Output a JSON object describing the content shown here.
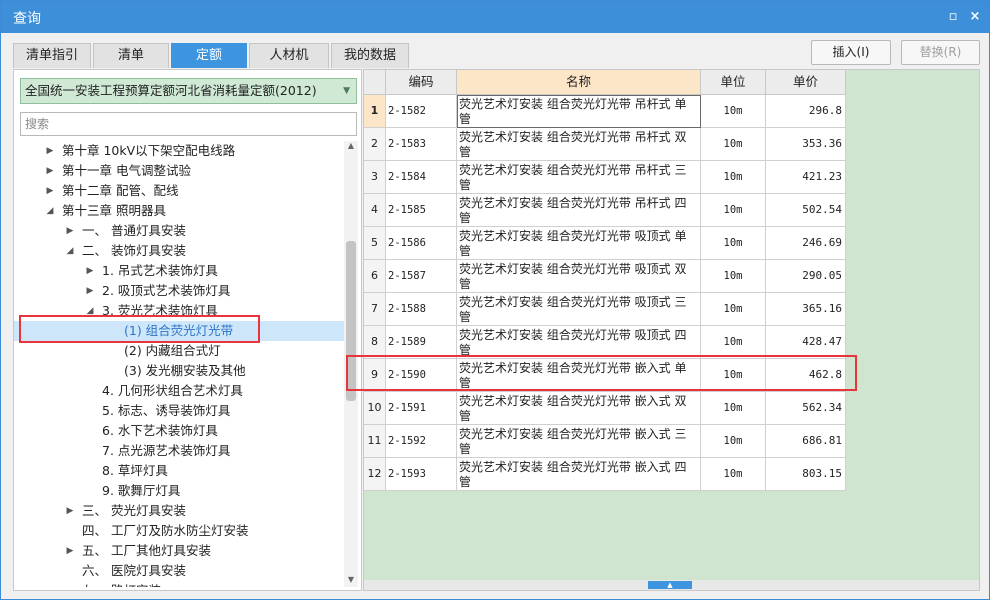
{
  "window": {
    "title": "查询",
    "restore_glyph": "▫",
    "close_glyph": "×"
  },
  "tabs": [
    {
      "label": "清单指引"
    },
    {
      "label": "清单"
    },
    {
      "label": "定额"
    },
    {
      "label": "人材机"
    },
    {
      "label": "我的数据"
    }
  ],
  "active_tab": "定额",
  "toolbar": {
    "insert_label": "插入(I)",
    "replace_label": "替换(R)"
  },
  "library": {
    "selected": "全国统一安装工程预算定额河北省消耗量定额(2012)",
    "arrow_icon": "chevron-down-icon"
  },
  "search": {
    "placeholder": "搜索",
    "value": ""
  },
  "tree": [
    {
      "label": "第十章 10kV以下架空配电线路",
      "toggle": "▶",
      "level": 0
    },
    {
      "label": "第十一章 电气调整试验",
      "toggle": "▶",
      "level": 0
    },
    {
      "label": "第十二章 配管、配线",
      "toggle": "▶",
      "level": 0
    },
    {
      "label": "第十三章 照明器具",
      "toggle": "◢",
      "level": 0
    },
    {
      "label": "一、 普通灯具安装",
      "toggle": "▶",
      "level": 1
    },
    {
      "label": "二、 装饰灯具安装",
      "toggle": "◢",
      "level": 1
    },
    {
      "label": "1. 吊式艺术装饰灯具",
      "toggle": "▶",
      "level": 2
    },
    {
      "label": "2. 吸顶式艺术装饰灯具",
      "toggle": "▶",
      "level": 2
    },
    {
      "label": "3. 荧光艺术装饰灯具",
      "toggle": "◢",
      "level": 2
    },
    {
      "label": "(1) 组合荧光灯光带",
      "toggle": "",
      "level": 3,
      "selected": true
    },
    {
      "label": "(2) 内藏组合式灯",
      "toggle": "",
      "level": 3
    },
    {
      "label": "(3) 发光棚安装及其他",
      "toggle": "",
      "level": 3
    },
    {
      "label": "4. 几何形状组合艺术灯具",
      "toggle": "",
      "level": 2
    },
    {
      "label": "5. 标志、诱导装饰灯具",
      "toggle": "",
      "level": 2
    },
    {
      "label": "6. 水下艺术装饰灯具",
      "toggle": "",
      "level": 2
    },
    {
      "label": "7. 点光源艺术装饰灯具",
      "toggle": "",
      "level": 2
    },
    {
      "label": "8. 草坪灯具",
      "toggle": "",
      "level": 2
    },
    {
      "label": "9. 歌舞厅灯具",
      "toggle": "",
      "level": 2
    },
    {
      "label": "三、 荧光灯具安装",
      "toggle": "▶",
      "level": 1
    },
    {
      "label": "四、 工厂灯及防水防尘灯安装",
      "toggle": "",
      "level": 1
    },
    {
      "label": "五、 工厂其他灯具安装",
      "toggle": "▶",
      "level": 1
    },
    {
      "label": "六、 医院灯具安装",
      "toggle": "",
      "level": 1
    },
    {
      "label": "七、 路灯安装",
      "toggle": "",
      "level": 1
    }
  ],
  "table": {
    "headers": {
      "code": "编码",
      "name": "名称",
      "unit": "单位",
      "price": "单价"
    },
    "rows": [
      {
        "num": "1",
        "code": "2-1582",
        "name": "荧光艺术灯安装 组合荧光灯光带 吊杆式 单管",
        "unit": "10m",
        "price": "296.8"
      },
      {
        "num": "2",
        "code": "2-1583",
        "name": "荧光艺术灯安装 组合荧光灯光带 吊杆式 双管",
        "unit": "10m",
        "price": "353.36"
      },
      {
        "num": "3",
        "code": "2-1584",
        "name": "荧光艺术灯安装 组合荧光灯光带 吊杆式 三管",
        "unit": "10m",
        "price": "421.23"
      },
      {
        "num": "4",
        "code": "2-1585",
        "name": "荧光艺术灯安装 组合荧光灯光带 吊杆式 四管",
        "unit": "10m",
        "price": "502.54"
      },
      {
        "num": "5",
        "code": "2-1586",
        "name": "荧光艺术灯安装 组合荧光灯光带 吸顶式 单管",
        "unit": "10m",
        "price": "246.69"
      },
      {
        "num": "6",
        "code": "2-1587",
        "name": "荧光艺术灯安装 组合荧光灯光带 吸顶式 双管",
        "unit": "10m",
        "price": "290.05"
      },
      {
        "num": "7",
        "code": "2-1588",
        "name": "荧光艺术灯安装 组合荧光灯光带 吸顶式 三管",
        "unit": "10m",
        "price": "365.16"
      },
      {
        "num": "8",
        "code": "2-1589",
        "name": "荧光艺术灯安装 组合荧光灯光带 吸顶式 四管",
        "unit": "10m",
        "price": "428.47"
      },
      {
        "num": "9",
        "code": "2-1590",
        "name": "荧光艺术灯安装 组合荧光灯光带 嵌入式 单管",
        "unit": "10m",
        "price": "462.8"
      },
      {
        "num": "10",
        "code": "2-1591",
        "name": "荧光艺术灯安装 组合荧光灯光带 嵌入式 双管",
        "unit": "10m",
        "price": "562.34"
      },
      {
        "num": "11",
        "code": "2-1592",
        "name": "荧光艺术灯安装 组合荧光灯光带 嵌入式 三管",
        "unit": "10m",
        "price": "686.81"
      },
      {
        "num": "12",
        "code": "2-1593",
        "name": "荧光艺术灯安装 组合荧光灯光带 嵌入式 四管",
        "unit": "10m",
        "price": "803.15"
      }
    ]
  },
  "colors": {
    "title_bar": "#3c8fd8",
    "active_tab": "#3d95e0",
    "library_bg": "#cfe9d5",
    "grid_empty_bg": "#cfe5cf",
    "name_header_bg": "#fde6c8",
    "highlight_border": "#e8343b"
  }
}
